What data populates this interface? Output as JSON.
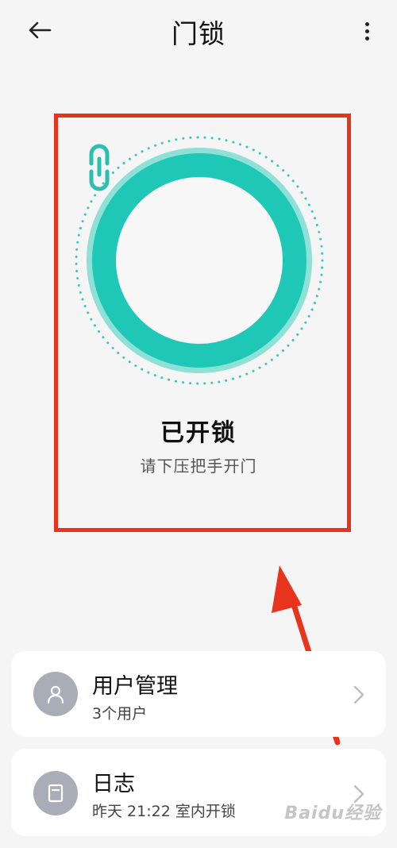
{
  "header": {
    "title": "门锁"
  },
  "lock": {
    "status": "已开锁",
    "hint": "请下压把手开门"
  },
  "cards": {
    "users": {
      "title": "用户管理",
      "subtitle": "3个用户",
      "icon": "user-icon"
    },
    "logs": {
      "title": "日志",
      "subtitle": "昨天 21:22 室内开锁",
      "icon": "log-icon"
    }
  },
  "watermark": "Baidu经验",
  "colors": {
    "accent": "#1ec7b6",
    "highlight": "#e8341c",
    "avatar_bg": "#a9adb8"
  }
}
